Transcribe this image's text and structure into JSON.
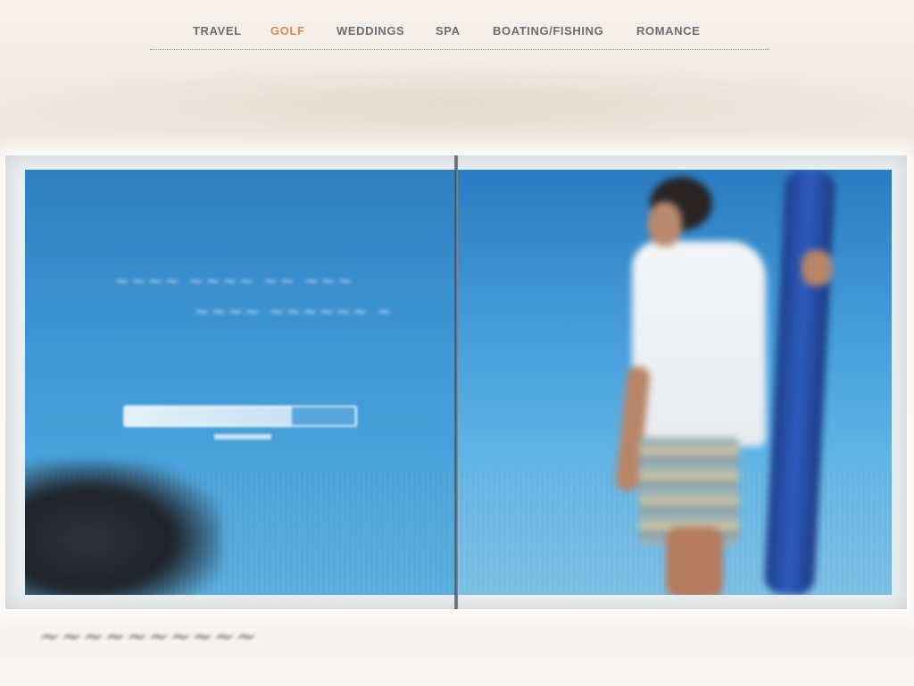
{
  "nav": {
    "items": [
      {
        "label": "TRAVEL",
        "active": false
      },
      {
        "label": "GOLF",
        "active": true
      },
      {
        "label": "WEDDINGS",
        "active": false
      },
      {
        "label": "SPA",
        "active": false
      },
      {
        "label": "BOATING/FISHING",
        "active": false
      },
      {
        "label": "ROMANCE",
        "active": false
      }
    ],
    "active_color": "#d98a58",
    "text_color": "#6a6f73"
  },
  "colors": {
    "sky_blue": "#3e95d3",
    "surfboard": "#2f5cbf"
  }
}
